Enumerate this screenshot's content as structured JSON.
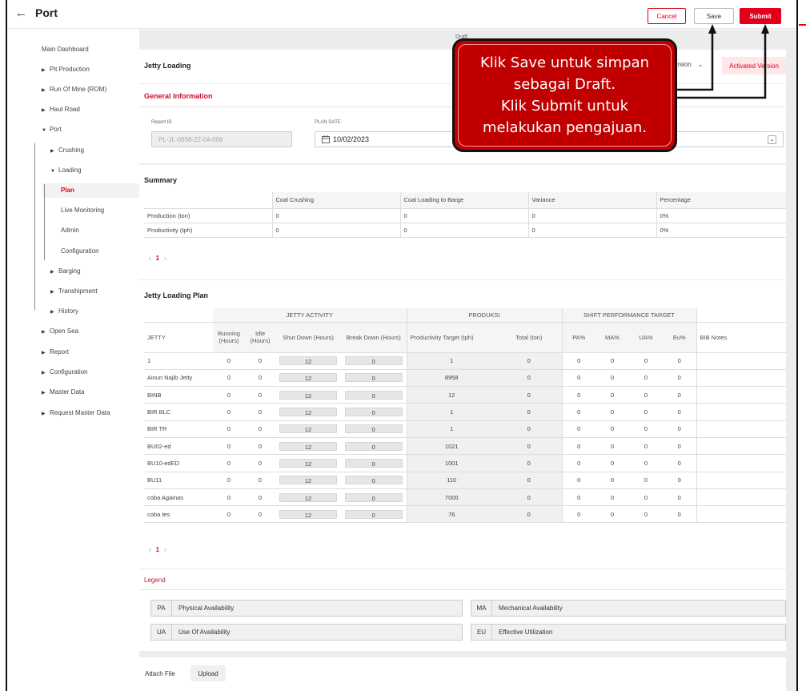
{
  "header": {
    "back_icon": "←",
    "title": "Port",
    "cancel": "Cancel",
    "save": "Save",
    "submit": "Submit"
  },
  "sidebar": {
    "items": [
      {
        "label": "Main Dashboard"
      },
      {
        "label": "Pit Production"
      },
      {
        "label": "Run Of Mine (ROM)"
      },
      {
        "label": "Haul Road"
      },
      {
        "label": "Port"
      },
      {
        "label": "Crushing"
      },
      {
        "label": "Loading"
      },
      {
        "label": "Plan"
      },
      {
        "label": "Live Monitoring"
      },
      {
        "label": "Admin"
      },
      {
        "label": "Configuration"
      },
      {
        "label": "Barging"
      },
      {
        "label": "Transhipment"
      },
      {
        "label": "History"
      },
      {
        "label": "Open Sea"
      },
      {
        "label": "Report"
      },
      {
        "label": "Configuration"
      },
      {
        "label": "Master Data"
      },
      {
        "label": "Request Master Data"
      }
    ]
  },
  "page": {
    "status": "Draft",
    "form_title": "Jetty Loading",
    "version_select": "Version",
    "activated_version": "Activated Version"
  },
  "general": {
    "title": "General Information",
    "report_id_label": "Report ID",
    "report_id_value": "PL-JL-0058-22-04-006",
    "plan_date_label": "PLAN DATE",
    "plan_date_value": "10/02/2023"
  },
  "summary": {
    "title": "Summary",
    "columns": [
      "",
      "Coal Crushing",
      "Coal Loading to Barge",
      "Variance",
      "Percentage"
    ],
    "rows": [
      [
        "Production (ton)",
        "0",
        "0",
        "0",
        "0%"
      ],
      [
        "Productivity (tph)",
        "0",
        "0",
        "0",
        "0%"
      ]
    ],
    "page": "1"
  },
  "plan": {
    "title": "Jetty Loading Plan",
    "group_headers": {
      "activity": "JETTY ACTIVITY",
      "produksi": "PRODUKSI",
      "shift": "SHIFT PERFORMANCE TARGET"
    },
    "columns": [
      "JETTY",
      "Running (Hours)",
      "Idle (Hours)",
      "Shut Down (Hours)",
      "Break Down (Hours)",
      "Productivity Target (tph)",
      "Total (ton)",
      "PA%",
      "MA%",
      "UA%",
      "Eu%",
      "BIB Notes"
    ],
    "rows": [
      [
        "1",
        "0",
        "0",
        "12",
        "0",
        "1",
        "0",
        "0",
        "0",
        "0",
        "0"
      ],
      [
        "Ainun Najib Jetty",
        "0",
        "0",
        "12",
        "0",
        "8958",
        "0",
        "0",
        "0",
        "0",
        "0"
      ],
      [
        "BINB",
        "0",
        "0",
        "12",
        "0",
        "12",
        "0",
        "0",
        "0",
        "0",
        "0"
      ],
      [
        "BIR BLC",
        "0",
        "0",
        "12",
        "0",
        "1",
        "0",
        "0",
        "0",
        "0",
        "0"
      ],
      [
        "BIR TR",
        "0",
        "0",
        "12",
        "0",
        "1",
        "0",
        "0",
        "0",
        "0",
        "0"
      ],
      [
        "BU02-ed",
        "0",
        "0",
        "12",
        "0",
        "1021",
        "0",
        "0",
        "0",
        "0",
        "0"
      ],
      [
        "BU10-edED",
        "0",
        "0",
        "12",
        "0",
        "1001",
        "0",
        "0",
        "0",
        "0",
        "0"
      ],
      [
        "BU11",
        "0",
        "0",
        "12",
        "0",
        "110",
        "0",
        "0",
        "0",
        "0",
        "0"
      ],
      [
        "coba Againas",
        "0",
        "0",
        "12",
        "0",
        "7000",
        "0",
        "0",
        "0",
        "0",
        "0"
      ],
      [
        "coba tes",
        "0",
        "0",
        "12",
        "0",
        "76",
        "0",
        "0",
        "0",
        "0",
        "0"
      ]
    ],
    "page": "1"
  },
  "legend": {
    "title": "Legend",
    "items": [
      {
        "key": "PA",
        "value": "Physical Availability"
      },
      {
        "key": "MA",
        "value": "Mechanical Availability"
      },
      {
        "key": "UA",
        "value": "Use Of Availability"
      },
      {
        "key": "EU",
        "value": "Effective Utilization"
      }
    ]
  },
  "attach": {
    "label": "Attach File",
    "upload": "Upload"
  },
  "callout": {
    "line1": "Klik Save untuk simpan",
    "line2": "sebagai Draft.",
    "line3": "Klik Submit untuk",
    "line4": "melakukan pengajuan."
  },
  "icons": {
    "pager_prev": "‹",
    "pager_next": "›",
    "calendar": "calendar-icon",
    "chevron": "chevron-down-icon"
  },
  "colors": {
    "accent": "#e3001b",
    "callout": "#c00000"
  }
}
